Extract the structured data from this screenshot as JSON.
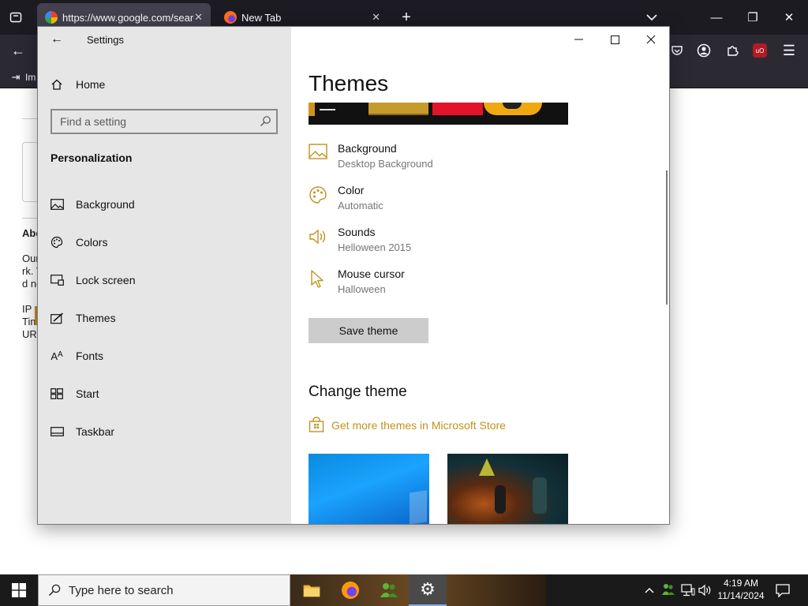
{
  "browser": {
    "tabs": [
      {
        "title": "https://www.google.com/search",
        "active": true
      },
      {
        "title": "New Tab",
        "active": false
      }
    ],
    "bookmark_label": "Im"
  },
  "webpage": {
    "fragments": [
      "Abo",
      "Our",
      "rk. T",
      "d no",
      "IP a",
      "Tim",
      "URL"
    ]
  },
  "settings": {
    "window_title": "Settings",
    "home_label": "Home",
    "search_placeholder": "Find a setting",
    "section_label": "Personalization",
    "nav": [
      {
        "label": "Background",
        "icon": "picture-icon"
      },
      {
        "label": "Colors",
        "icon": "palette-icon"
      },
      {
        "label": "Lock screen",
        "icon": "lock-screen-icon"
      },
      {
        "label": "Themes",
        "icon": "themes-icon"
      },
      {
        "label": "Fonts",
        "icon": "fonts-icon"
      },
      {
        "label": "Start",
        "icon": "start-icon"
      },
      {
        "label": "Taskbar",
        "icon": "taskbar-icon"
      }
    ],
    "page_title": "Themes",
    "properties": [
      {
        "name": "Background",
        "value": "Desktop Background",
        "icon": "picture-icon"
      },
      {
        "name": "Color",
        "value": "Automatic",
        "icon": "palette-icon"
      },
      {
        "name": "Sounds",
        "value": "Helloween 2015",
        "icon": "speaker-icon"
      },
      {
        "name": "Mouse cursor",
        "value": "Halloween",
        "icon": "cursor-icon"
      }
    ],
    "save_label": "Save theme",
    "change_theme_heading": "Change theme",
    "store_link": "Get more themes in Microsoft Store",
    "accent_color": "#c2921c"
  },
  "taskbar": {
    "search_placeholder": "Type here to search",
    "time": "4:19 AM",
    "date": "11/14/2024"
  }
}
